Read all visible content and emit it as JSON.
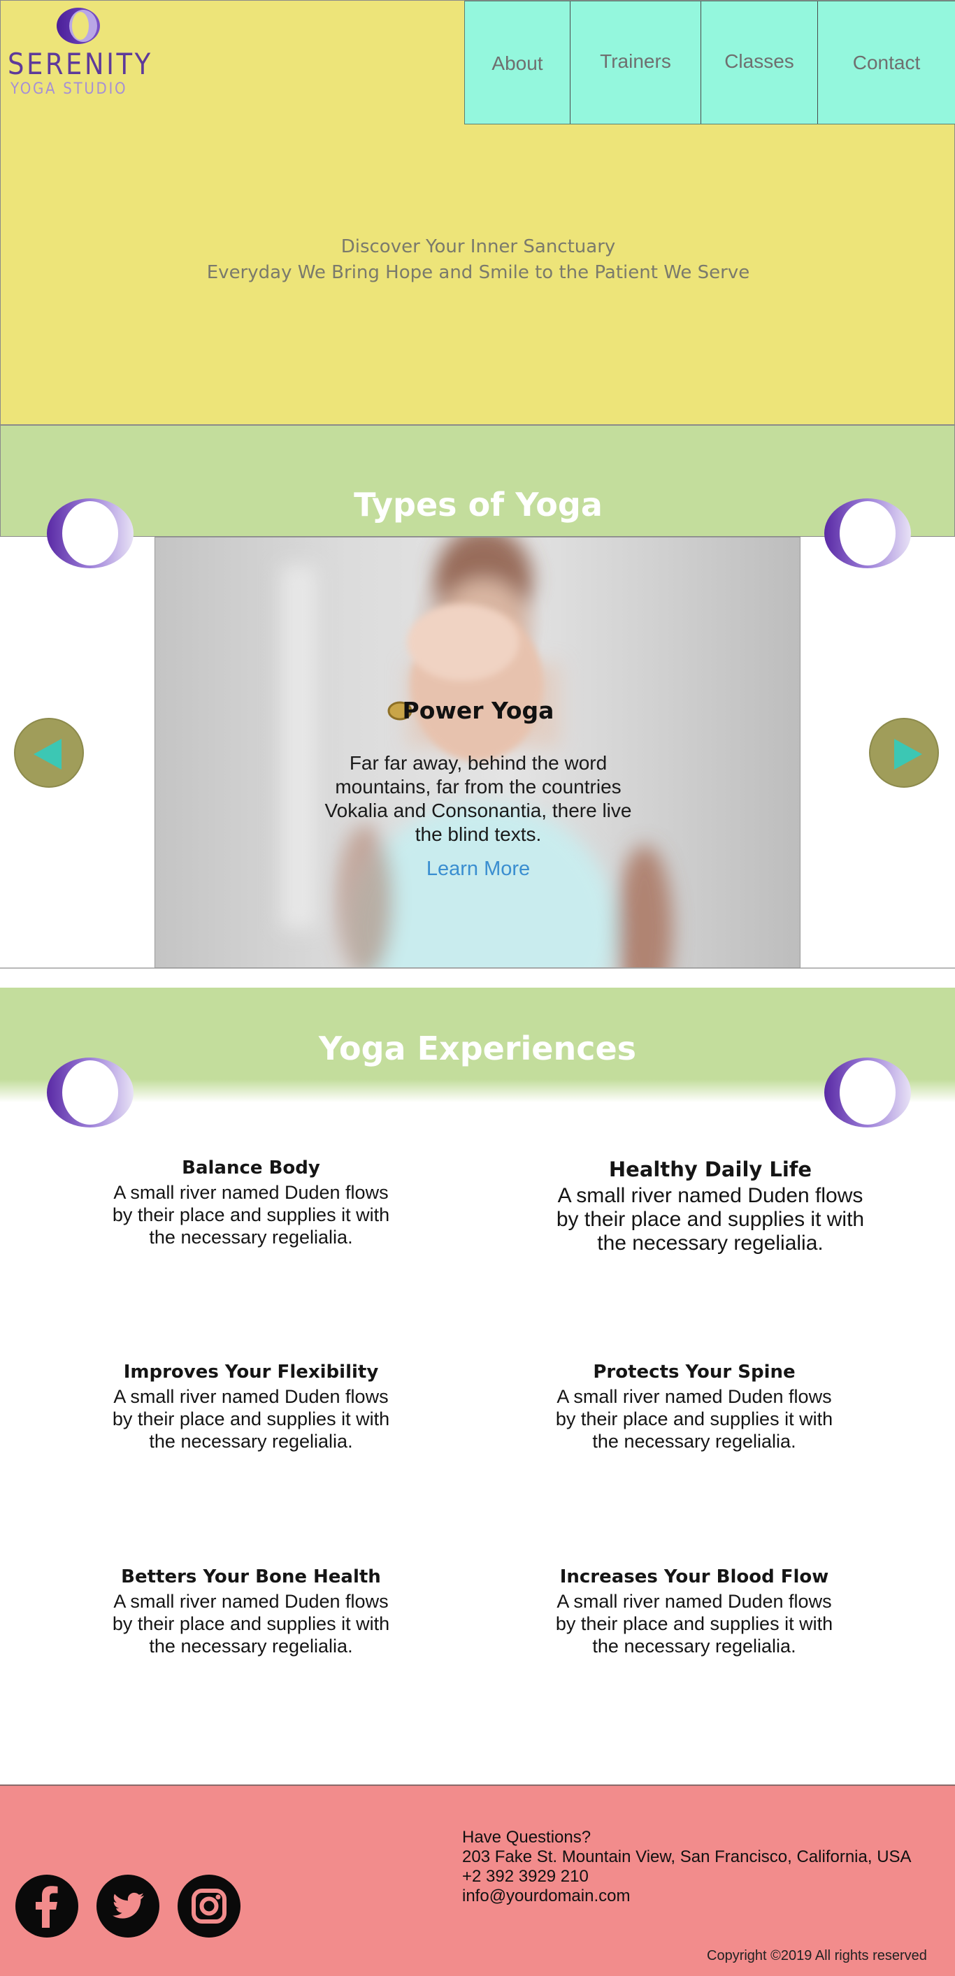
{
  "brand": {
    "title": "SERENITY",
    "subtitle": "YOGA STUDIO",
    "colors": {
      "primary": "#5e3a9a",
      "secondary": "#a58fd6"
    }
  },
  "nav": {
    "items": [
      {
        "label": "About"
      },
      {
        "label": "Trainers"
      },
      {
        "label": "Classes"
      },
      {
        "label": "Contact"
      }
    ]
  },
  "hero": {
    "line1": "Discover Your Inner Sanctuary",
    "line2": "Everyday We Bring Hope and Smile to the Patient We Serve",
    "background": "#ede479"
  },
  "types": {
    "title": "Types of Yoga",
    "slide": {
      "title": "Power Yoga",
      "text": "Far far away, behind the word mountains, far from the countries Vokalia and Consonantia, there live the blind texts.",
      "link": "Learn More"
    },
    "prev_icon": "arrow-left-icon",
    "next_icon": "arrow-right-icon"
  },
  "experiences": {
    "title": "Yoga Experiences",
    "items": [
      {
        "title": "Balance Body",
        "text": "A small river named Duden flows by their place and supplies it with the necessary regelialia."
      },
      {
        "title": "Healthy Daily Life",
        "text": "A small river named Duden flows by their place and supplies it with the necessary regelialia."
      },
      {
        "title": "Improves Your Flexibility",
        "text": "A small river named Duden flows by their place and supplies it with the necessary regelialia."
      },
      {
        "title": "Protects Your Spine",
        "text": "A small river named Duden flows by their place and supplies it with the necessary regelialia."
      },
      {
        "title": "Betters Your Bone Health",
        "text": "A small river named Duden flows by their place and supplies it with the necessary regelialia."
      },
      {
        "title": "Increases Your Blood Flow",
        "text": "A small river named Duden flows by their place and supplies it with the necessary regelialia."
      }
    ]
  },
  "footer": {
    "question": "Have Questions?",
    "address": "203 Fake St. Mountain View, San Francisco, California, USA",
    "phone": "+2 392 3929 210",
    "email": "info@yourdomain.com",
    "copyright": "Copyright ©2019 All rights reserved",
    "social": [
      "facebook-icon",
      "twitter-icon",
      "instagram-icon"
    ],
    "background": "#f28c8c"
  }
}
